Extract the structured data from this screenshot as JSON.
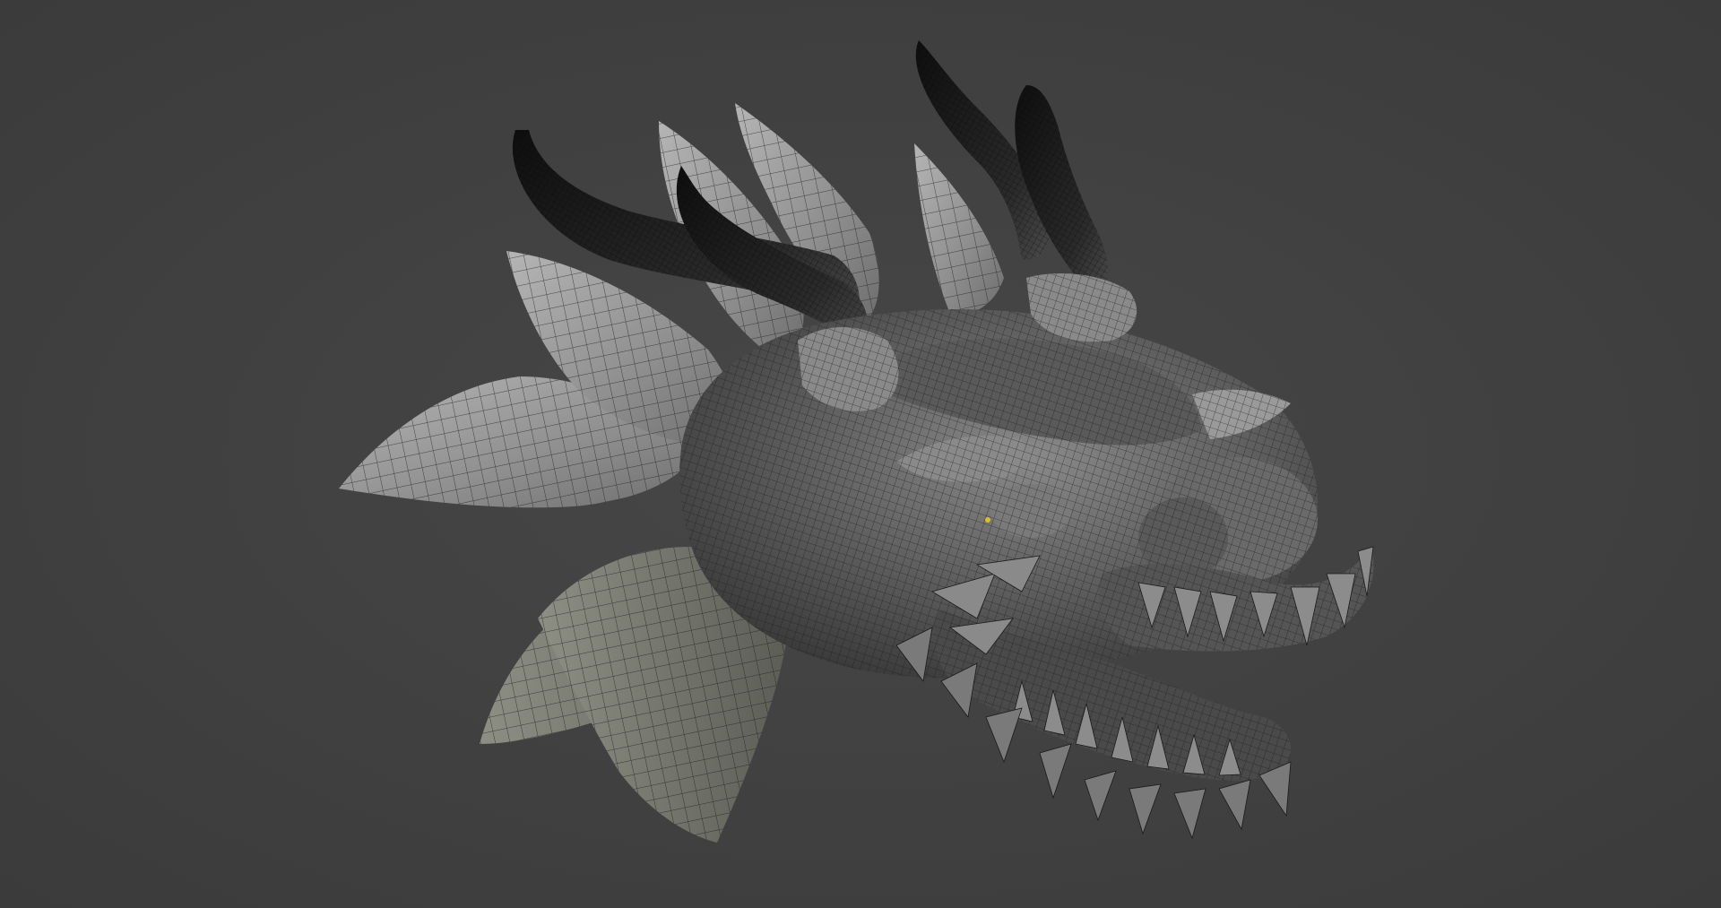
{
  "viewport": {
    "background_color": "#404040",
    "model": {
      "subject": "dragon-head",
      "display_mode": "wireframe-over-solid",
      "colors": {
        "skin": "#6a6a6a",
        "skin_light": "#9a9a9a",
        "frill": "#a9a9a9",
        "horn": "#1c1c1c",
        "wire": "#1a1a1a",
        "eye": "#d6c320"
      }
    }
  }
}
